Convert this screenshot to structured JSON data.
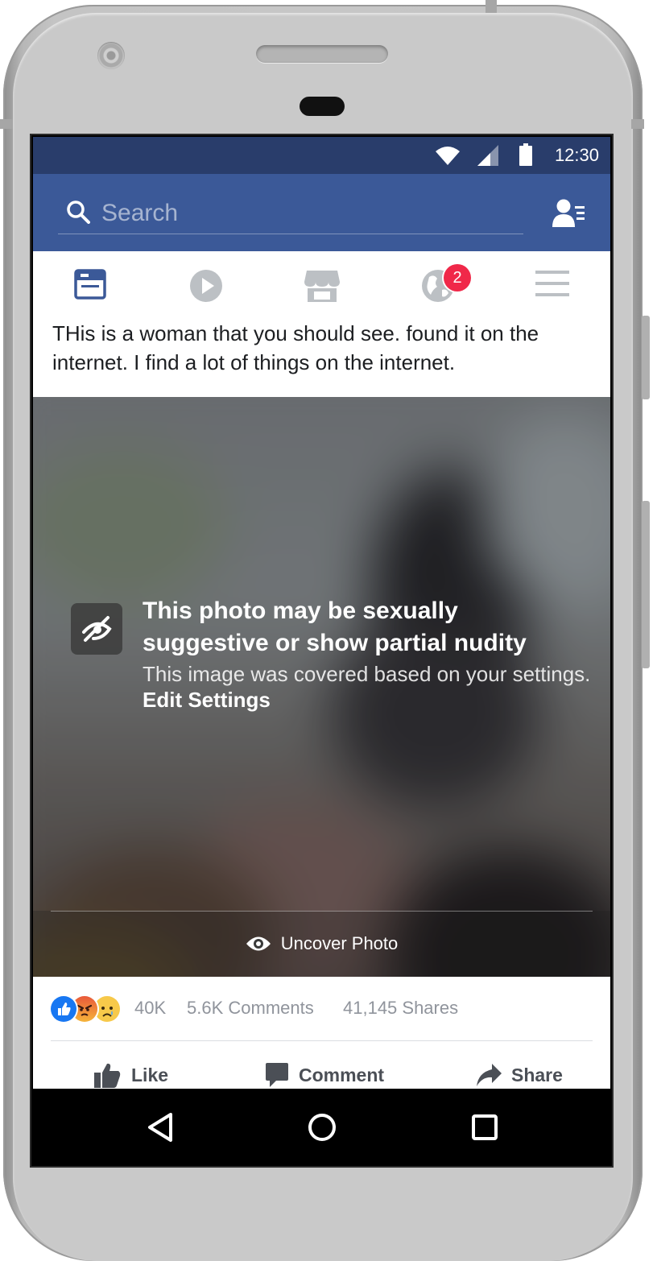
{
  "status_bar": {
    "time": "12:30",
    "icons": [
      "wifi-icon",
      "signal-icon",
      "battery-icon"
    ]
  },
  "top_bar": {
    "search_placeholder": "Search",
    "brand_color": "#3b5998",
    "status_color": "#293d6b"
  },
  "nav_tabs": [
    {
      "name": "news-feed",
      "icon": "news-feed-icon",
      "active": true
    },
    {
      "name": "watch",
      "icon": "video-play-icon",
      "active": false
    },
    {
      "name": "marketplace",
      "icon": "marketplace-store-icon",
      "active": false
    },
    {
      "name": "notifications",
      "icon": "globe-icon",
      "badge": "2",
      "active": false
    },
    {
      "name": "menu",
      "icon": "hamburger-menu-icon",
      "active": false
    }
  ],
  "post": {
    "text": "THis is a woman that you should see. found it on the internet. I find a lot of things on the internet."
  },
  "sensitive_cover": {
    "title": "This photo may be sexually suggestive or show partial nudity",
    "subtitle": "This image was covered based on your settings.",
    "edit_link": "Edit Settings",
    "uncover_label": "Uncover Photo"
  },
  "engagement": {
    "reactions": [
      "like-reaction-icon",
      "angry-reaction-icon",
      "sad-reaction-icon"
    ],
    "reaction_count": "40K",
    "comments": "5.6K Comments",
    "shares": "41,145 Shares"
  },
  "actions": {
    "like": "Like",
    "comment": "Comment",
    "share": "Share"
  },
  "android_nav": [
    "back-icon",
    "home-icon",
    "recents-icon"
  ]
}
